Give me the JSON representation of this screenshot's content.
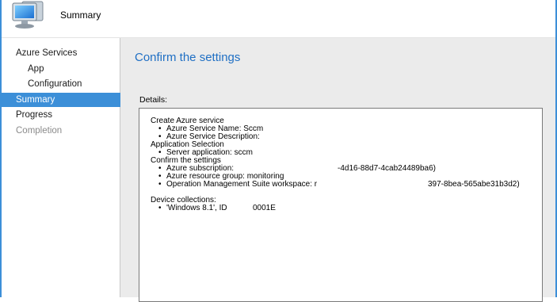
{
  "header": {
    "title": "Summary",
    "icon": "computer-monitor-icon"
  },
  "sidebar": {
    "items": [
      {
        "label": "Azure Services",
        "level": 1,
        "state": "normal"
      },
      {
        "label": "App",
        "level": 2,
        "state": "normal"
      },
      {
        "label": "Configuration",
        "level": 2,
        "state": "normal"
      },
      {
        "label": "Summary",
        "level": 1,
        "state": "selected"
      },
      {
        "label": "Progress",
        "level": 1,
        "state": "normal"
      },
      {
        "label": "Completion",
        "level": 1,
        "state": "disabled"
      }
    ]
  },
  "main": {
    "title": "Confirm the settings",
    "details_label": "Details:",
    "details": {
      "create_azure_service": "Create Azure service",
      "azure_service_name": "Azure Service Name: Sccm",
      "azure_service_description": "Azure Service Description:",
      "application_selection": "Application Selection",
      "server_application": "Server application: sccm",
      "confirm_the_settings": "Confirm the settings",
      "azure_subscription": "Azure subscription:",
      "azure_subscription_tail": "-4d16-88d7-4cab24489ba6)",
      "azure_resource_group": "Azure resource group: monitoring",
      "oms_workspace": "Operation Management Suite workspace: r",
      "oms_workspace_tail": "397-8bea-565abe31b3d2)",
      "device_collections": "Device collections:",
      "device_entry": "'Windows 8.1', ID",
      "device_entry_tail": "0001E",
      "bullet": "•"
    }
  },
  "colors": {
    "accent": "#3c8fd8",
    "title_blue": "#1f6fc4",
    "content_bg": "#ebebeb"
  }
}
